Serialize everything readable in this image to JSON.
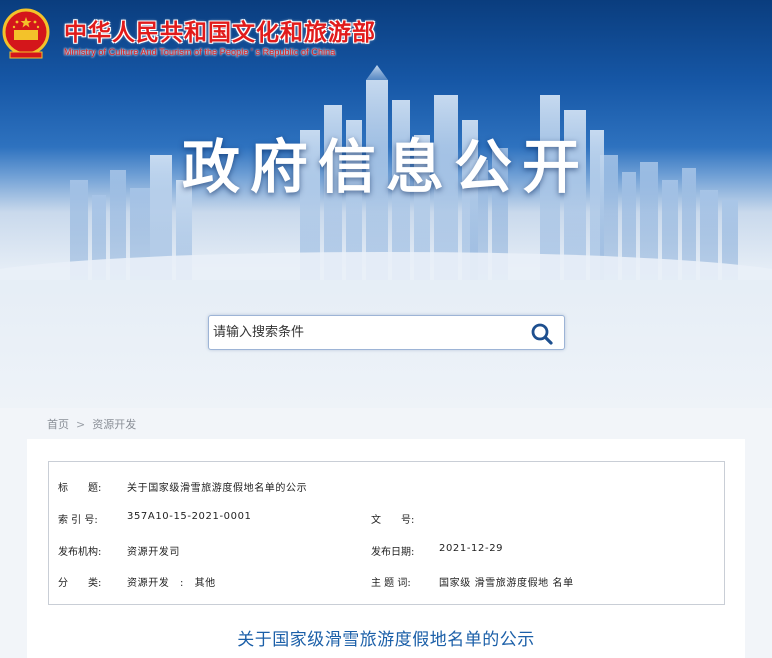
{
  "header": {
    "ministry_cn": "中华人民共和国文化和旅游部",
    "ministry_en": "Ministry of Culture And Tourism of the People ' s Republic of China",
    "banner_title": "政府信息公开"
  },
  "search": {
    "placeholder": "请输入搜索条件",
    "icon": "search-icon"
  },
  "breadcrumb": {
    "home": "首页",
    "separator": ">",
    "current": "资源开发"
  },
  "meta": {
    "title_label": "标　　题:",
    "title_value": "关于国家级滑雪旅游度假地名单的公示",
    "index_label": "索 引 号:",
    "index_value": "357A10-15-2021-0001",
    "docno_label": "文　　号:",
    "docno_value": "",
    "org_label": "发布机构:",
    "org_value": "资源开发司",
    "date_label": "发布日期:",
    "date_value": "2021-12-29",
    "category_label": "分　　类:",
    "category_value": "资源开发　:　其他",
    "keywords_label": "主 题 词:",
    "keywords_value": "国家级 滑雪旅游度假地 名单"
  },
  "article": {
    "title": "关于国家级滑雪旅游度假地名单的公示"
  },
  "colors": {
    "brand_red": "#e11b1b",
    "banner_blue": "#1657a6",
    "title_blue": "#1b5fa8",
    "border": "#c9ced6"
  }
}
